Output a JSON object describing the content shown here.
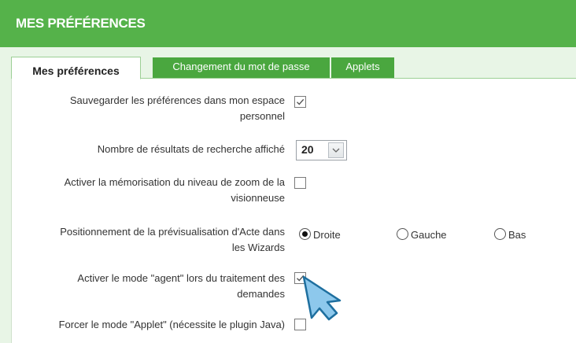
{
  "header": {
    "title": "MES PRÉFÉRENCES"
  },
  "tabs": [
    {
      "label": "Mes préférences",
      "active": true
    },
    {
      "label": "Changement du mot de passe",
      "active": false
    },
    {
      "label": "Applets",
      "active": false
    }
  ],
  "settings": {
    "save_prefs": {
      "label_line1": "Sauvegarder les préférences dans mon espace",
      "label_line2": "personnel",
      "checked": true
    },
    "results_count": {
      "label": "Nombre de résultats de recherche affiché",
      "value": "20"
    },
    "zoom_memory": {
      "label_line1": "Activer la mémorisation du niveau de zoom de la",
      "label_line2": "visionneuse",
      "checked": false
    },
    "preview_position": {
      "label_line1": "Positionnement de la prévisualisation d'Acte dans",
      "label_line2": "les Wizards",
      "options": [
        "Droite",
        "Gauche",
        "Bas"
      ],
      "selected": "Droite"
    },
    "agent_mode": {
      "label_line1": "Activer le mode \"agent\" lors du traitement des",
      "label_line2": "demandes",
      "checked": true
    },
    "applet_mode": {
      "label": "Forcer le mode \"Applet\" (nécessite le plugin Java)",
      "checked": false
    }
  },
  "colors": {
    "header": "#55b24a",
    "tab": "#4aa73f",
    "panel": "#e8f5e6",
    "cursor": "#8dc8ec"
  },
  "icons": {
    "cursor": "arrow-cursor-icon",
    "checkmark": "checkmark-icon",
    "dropdown": "chevron-down-icon"
  }
}
